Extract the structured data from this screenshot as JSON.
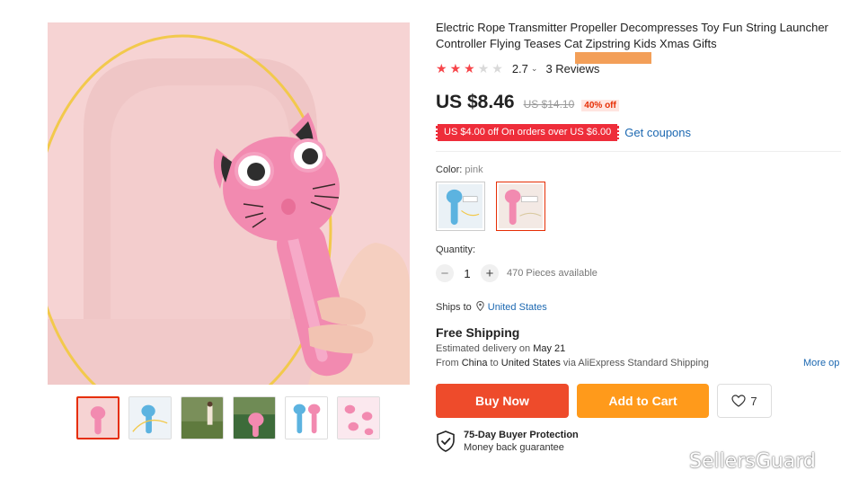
{
  "product": {
    "title": "Electric Rope Transmitter Propeller Decompresses Toy Fun String Launcher Controller Flying Teases Cat Zipstring Kids Xmas Gifts",
    "rating": {
      "stars_filled": 3,
      "stars_total": 5,
      "value": "2.7",
      "chevron": "⌄",
      "reviews": "3 Reviews"
    },
    "price": {
      "current": "US $8.46",
      "original": "US $14.10",
      "discount": "40% off"
    },
    "coupon": {
      "text": "US $4.00 off On orders over US $6.00",
      "link": "Get coupons"
    },
    "color": {
      "label": "Color: ",
      "value": "pink",
      "options": [
        {
          "name": "blue",
          "color": "#5cb3e0"
        },
        {
          "name": "pink",
          "color": "#f29bb5"
        }
      ],
      "selected": "pink"
    },
    "quantity": {
      "label": "Quantity:",
      "value": "1",
      "minus": "−",
      "plus": "+",
      "available": "470 Pieces available"
    },
    "shipping": {
      "ships_to_label": "Ships to",
      "country": "United States",
      "free_shipping": "Free Shipping",
      "delivery_prefix": "Estimated delivery on ",
      "delivery_date": "May 21",
      "from_prefix": "From ",
      "from_country": "China",
      "to_word": " to ",
      "to_country": "United States",
      "via": " via AliExpress Standard Shipping",
      "more_options": "More op"
    },
    "actions": {
      "buy_now": "Buy Now",
      "add_to_cart": "Add to Cart",
      "wishlist_count": "7"
    },
    "protection": {
      "title": "75-Day Buyer Protection",
      "subtitle": "Money back guarantee"
    }
  },
  "gallery": {
    "thumbnail_count": 6,
    "active_index": 0
  },
  "watermark": {
    "text": "SellersGuard"
  },
  "colors": {
    "accent_red": "#ee4b2b",
    "accent_orange": "#ff9a1b",
    "link_blue": "#1c68b1",
    "star_red": "#f7454a",
    "coupon_red": "#ee2d3a",
    "product_pink": "#f28ab0",
    "background_pink": "#f6d3d3"
  }
}
